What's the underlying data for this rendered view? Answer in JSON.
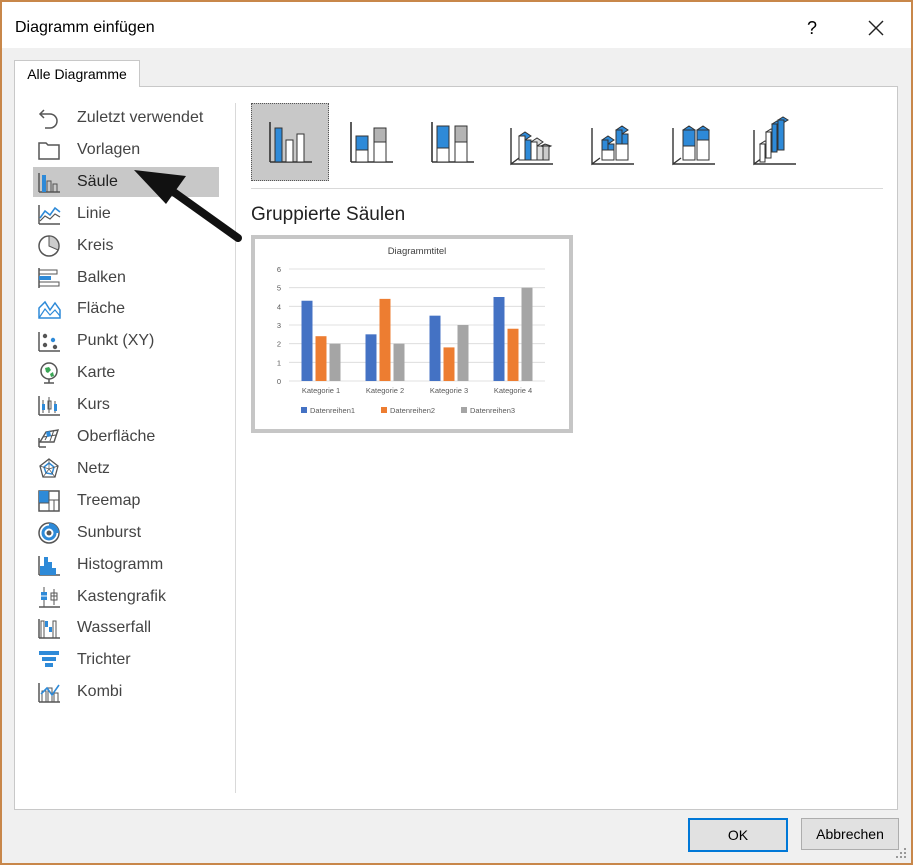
{
  "dialog": {
    "title": "Diagramm einfügen",
    "help_label": "?",
    "tab_label": "Alle Diagramme",
    "ok_label": "OK",
    "cancel_label": "Abbrechen"
  },
  "categories": [
    {
      "label": "Zuletzt verwendet",
      "icon": "recent-icon"
    },
    {
      "label": "Vorlagen",
      "icon": "folder-icon"
    },
    {
      "label": "Säule",
      "icon": "column-chart-icon",
      "selected": true
    },
    {
      "label": "Linie",
      "icon": "line-chart-icon"
    },
    {
      "label": "Kreis",
      "icon": "pie-chart-icon"
    },
    {
      "label": "Balken",
      "icon": "bar-chart-icon"
    },
    {
      "label": "Fläche",
      "icon": "area-chart-icon"
    },
    {
      "label": "Punkt (XY)",
      "icon": "scatter-chart-icon"
    },
    {
      "label": "Karte",
      "icon": "map-chart-icon"
    },
    {
      "label": "Kurs",
      "icon": "stock-chart-icon"
    },
    {
      "label": "Oberfläche",
      "icon": "surface-chart-icon"
    },
    {
      "label": "Netz",
      "icon": "radar-chart-icon"
    },
    {
      "label": "Treemap",
      "icon": "treemap-icon"
    },
    {
      "label": "Sunburst",
      "icon": "sunburst-icon"
    },
    {
      "label": "Histogramm",
      "icon": "histogram-icon"
    },
    {
      "label": "Kastengrafik",
      "icon": "box-whisker-icon"
    },
    {
      "label": "Wasserfall",
      "icon": "waterfall-icon"
    },
    {
      "label": "Trichter",
      "icon": "funnel-icon"
    },
    {
      "label": "Kombi",
      "icon": "combo-chart-icon"
    }
  ],
  "subtypes": [
    {
      "icon": "clustered-column-icon",
      "selected": true
    },
    {
      "icon": "stacked-column-icon"
    },
    {
      "icon": "stacked-100-column-icon"
    },
    {
      "icon": "3d-clustered-column-icon"
    },
    {
      "icon": "3d-stacked-column-icon"
    },
    {
      "icon": "3d-stacked-100-column-icon"
    },
    {
      "icon": "3d-column-icon"
    }
  ],
  "selected_subtype_title": "Gruppierte Säulen",
  "colors": {
    "series1": "#4472c4",
    "series2": "#ed7d31",
    "series3": "#a5a5a5",
    "icon_blue": "#2e8ad8",
    "selection": "#c8c8c8",
    "dialog_border": "#c8874a"
  },
  "chart_data": {
    "type": "bar",
    "title": "Diagrammtitel",
    "categories": [
      "Kategorie 1",
      "Kategorie 2",
      "Kategorie 3",
      "Kategorie 4"
    ],
    "series": [
      {
        "name": "Datenreihen1",
        "values": [
          4.3,
          2.5,
          3.5,
          4.5
        ]
      },
      {
        "name": "Datenreihen2",
        "values": [
          2.4,
          4.4,
          1.8,
          2.8
        ]
      },
      {
        "name": "Datenreihen3",
        "values": [
          2,
          2,
          3,
          5
        ]
      }
    ],
    "yticks": [
      "0",
      "1",
      "2",
      "3",
      "4",
      "5",
      "6"
    ],
    "ylim": [
      0,
      6
    ],
    "grid": true,
    "legend": "bottom"
  }
}
